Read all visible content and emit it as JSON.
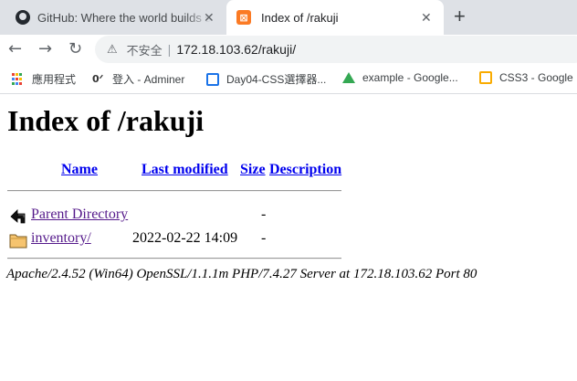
{
  "browser": {
    "tabs": [
      {
        "title": "GitHub: Where the world builds software · GitHub",
        "icon": "github-icon"
      },
      {
        "title": "Index of /rakuji",
        "icon": "xampp-icon"
      }
    ],
    "new_tab_label": "+",
    "close_label": "✕",
    "omnibox": {
      "security_label": "不安全",
      "url": "172.18.103.62/rakuji/"
    },
    "bookmarks": [
      {
        "label": "應用程式",
        "icon": "apps-icon"
      },
      {
        "label": "登入 - Adminer",
        "icon": "adminer-icon"
      },
      {
        "label": "Day04-CSS選擇器...",
        "icon": "day04-icon"
      },
      {
        "label": "example - Google...",
        "icon": "google-drive-icon"
      },
      {
        "label": "CSS3 - Google",
        "icon": "google-slides-icon"
      }
    ]
  },
  "page": {
    "heading": "Index of /rakuji",
    "columns": {
      "name": "Name",
      "last_modified": "Last modified",
      "size": "Size",
      "description": "Description"
    },
    "rows": [
      {
        "name": "Parent Directory",
        "modified": "",
        "size": "-",
        "icon": "back-arrow-icon"
      },
      {
        "name": "inventory/",
        "modified": "2022-02-22 14:09",
        "size": "-",
        "icon": "folder-icon"
      }
    ],
    "address": "Apache/2.4.52 (Win64) OpenSSL/1.1.1m PHP/7.4.27 Server at 172.18.103.62 Port 80"
  }
}
